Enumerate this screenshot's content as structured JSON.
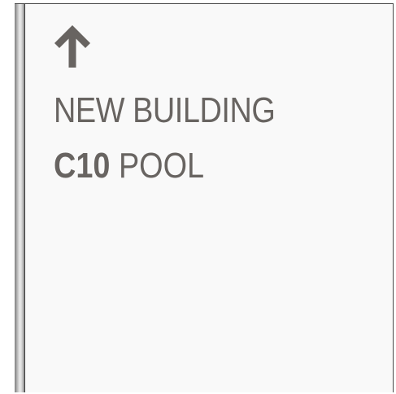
{
  "sign": {
    "icon": "arrow-up-icon",
    "line1": "NEW BUILDING",
    "code": "C10",
    "destination": "POOL",
    "text_color": "#686461",
    "background_color": "#f9f9f9"
  }
}
